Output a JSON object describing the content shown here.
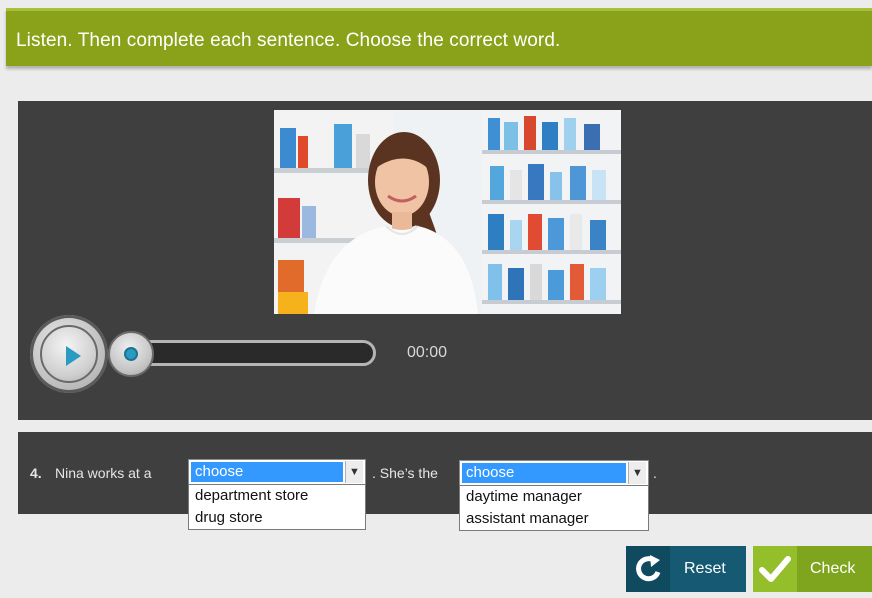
{
  "instructions": "Listen. Then complete each sentence. Choose the correct word.",
  "audio": {
    "time": "00:00",
    "progress": 0
  },
  "question": {
    "number": "4.",
    "text_before": "Nina works at a",
    "text_middle": ". She’s the",
    "text_end": ".",
    "select1": {
      "value": "choose",
      "options": [
        "department store",
        "drug store"
      ]
    },
    "select2": {
      "value": "choose",
      "options": [
        "daytime manager",
        "assistant manager"
      ]
    }
  },
  "buttons": {
    "reset": "Reset",
    "check": "Check"
  },
  "colors": {
    "banner": "#8aa21a",
    "panel": "#3f3f3f",
    "accent_blue": "#2a9bc1",
    "reset_button": "#155a72",
    "check_button": "#7ea51d"
  }
}
